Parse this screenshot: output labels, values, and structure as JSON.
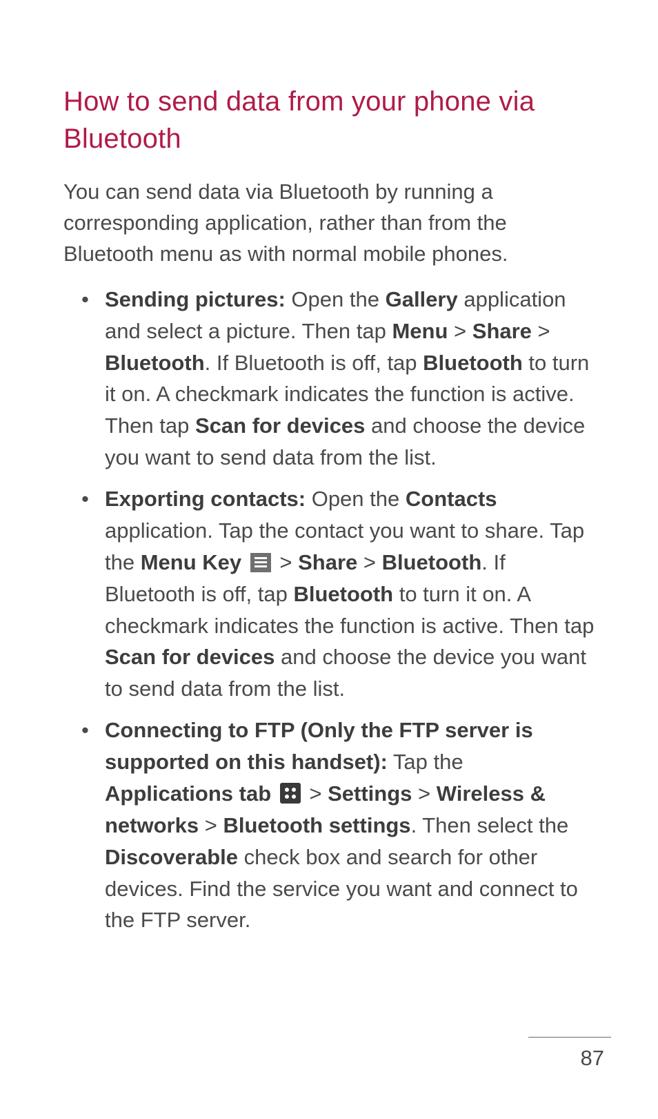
{
  "heading": "How to send data from your phone via Bluetooth",
  "intro": "You can send data via Bluetooth by running a corresponding application, rather than from the Bluetooth menu as with normal mobile phones.",
  "bullets": {
    "b1": {
      "lead": "Sending pictures:",
      "t1": " Open the ",
      "gallery": "Gallery",
      "t2": " application and select a picture. Then tap ",
      "menu": "Menu",
      "gt1": " > ",
      "share": "Share",
      "gt2": " > ",
      "bluetooth": "Bluetooth",
      "t3": ". If Bluetooth is off, tap ",
      "bluetooth2": "Bluetooth",
      "t4": " to turn it on. A checkmark indicates the function is active. Then tap ",
      "scan": "Scan for devices",
      "t5": " and choose the device you want to send data from the list."
    },
    "b2": {
      "lead": "Exporting contacts:",
      "t1": " Open the ",
      "contacts": "Contacts",
      "t2": " application. Tap the contact you want to share. Tap the ",
      "menukey": "Menu Key",
      "t3": " > ",
      "share": "Share",
      "t4": " > ",
      "bluetooth": "Bluetooth",
      "t5": ". If Bluetooth is off, tap ",
      "bluetooth2": "Bluetooth",
      "t6": " to turn it on. A checkmark indicates the function is active. Then tap ",
      "scan": "Scan for devices",
      "t7": " and choose the device you want to send data from the list."
    },
    "b3": {
      "lead": "Connecting to FTP (Only the FTP server is supported on this handset):",
      "t1": " Tap the ",
      "apptab": "Applications tab",
      "t2": " > ",
      "settings": "Settings",
      "t3": " > ",
      "wireless": "Wireless & networks",
      "t4": " > ",
      "btsettings": "Bluetooth settings",
      "t5": ". Then select the ",
      "discoverable": "Discoverable",
      "t6": " check box and search for other devices. Find the service you want and connect to the FTP server."
    }
  },
  "page_number": "87"
}
